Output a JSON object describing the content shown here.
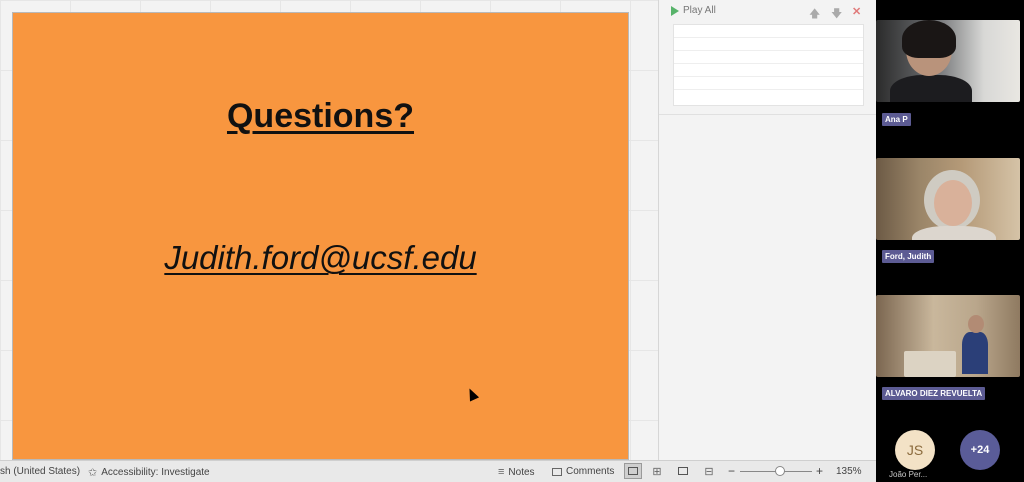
{
  "slide": {
    "title": "Questions?",
    "email": "Judith.ford@ucsf.edu"
  },
  "animation_pane": {
    "play_all_label": "Play All",
    "move_up_icon": "arrow-up-icon",
    "move_down_icon": "arrow-down-icon",
    "close_icon": "close-icon"
  },
  "status_bar": {
    "language": "sh (United States)",
    "accessibility": "Accessibility: Investigate",
    "notes": "Notes",
    "comments": "Comments",
    "zoom_minus": "−",
    "zoom_plus": "+",
    "zoom_level": "135%",
    "zoom_fraction": 0.55
  },
  "meeting": {
    "participants": [
      {
        "name": "Ana P"
      },
      {
        "name": "Ford, Judith"
      },
      {
        "name": "ALVARO DIEZ REVUELTA"
      }
    ],
    "avatar_initials": "JS",
    "avatar_name": "João Per...",
    "more_count": "+24"
  },
  "colors": {
    "slide_background": "#f8963f",
    "name_tag": "#5c5b93",
    "play_icon": "#57b36a"
  }
}
